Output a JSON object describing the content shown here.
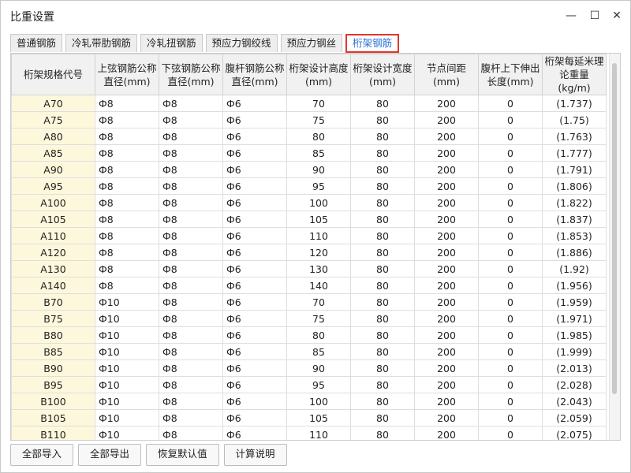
{
  "window": {
    "title": "比重设置"
  },
  "tabs": [
    {
      "label": "普通钢筋",
      "active": false
    },
    {
      "label": "冷轧带肋钢筋",
      "active": false
    },
    {
      "label": "冷轧扭钢筋",
      "active": false
    },
    {
      "label": "预应力钢绞线",
      "active": false
    },
    {
      "label": "预应力钢丝",
      "active": false
    },
    {
      "label": "桁架钢筋",
      "active": true
    }
  ],
  "table": {
    "headers": [
      "桁架规格代号",
      "上弦钢筋公称直径(mm)",
      "下弦钢筋公称直径(mm)",
      "腹杆钢筋公称直径(mm)",
      "桁架设计高度(mm)",
      "桁架设计宽度(mm)",
      "节点间距(mm)",
      "腹杆上下伸出长度(mm)",
      "桁架每延米理论重量(kg/m)"
    ],
    "rows": [
      [
        "A70",
        "Ф8",
        "Ф8",
        "Ф6",
        "70",
        "80",
        "200",
        "0",
        "(1.737)"
      ],
      [
        "A75",
        "Ф8",
        "Ф8",
        "Ф6",
        "75",
        "80",
        "200",
        "0",
        "(1.75)"
      ],
      [
        "A80",
        "Ф8",
        "Ф8",
        "Ф6",
        "80",
        "80",
        "200",
        "0",
        "(1.763)"
      ],
      [
        "A85",
        "Ф8",
        "Ф8",
        "Ф6",
        "85",
        "80",
        "200",
        "0",
        "(1.777)"
      ],
      [
        "A90",
        "Ф8",
        "Ф8",
        "Ф6",
        "90",
        "80",
        "200",
        "0",
        "(1.791)"
      ],
      [
        "A95",
        "Ф8",
        "Ф8",
        "Ф6",
        "95",
        "80",
        "200",
        "0",
        "(1.806)"
      ],
      [
        "A100",
        "Ф8",
        "Ф8",
        "Ф6",
        "100",
        "80",
        "200",
        "0",
        "(1.822)"
      ],
      [
        "A105",
        "Ф8",
        "Ф8",
        "Ф6",
        "105",
        "80",
        "200",
        "0",
        "(1.837)"
      ],
      [
        "A110",
        "Ф8",
        "Ф8",
        "Ф6",
        "110",
        "80",
        "200",
        "0",
        "(1.853)"
      ],
      [
        "A120",
        "Ф8",
        "Ф8",
        "Ф6",
        "120",
        "80",
        "200",
        "0",
        "(1.886)"
      ],
      [
        "A130",
        "Ф8",
        "Ф8",
        "Ф6",
        "130",
        "80",
        "200",
        "0",
        "(1.92)"
      ],
      [
        "A140",
        "Ф8",
        "Ф8",
        "Ф6",
        "140",
        "80",
        "200",
        "0",
        "(1.956)"
      ],
      [
        "B70",
        "Ф10",
        "Ф8",
        "Ф6",
        "70",
        "80",
        "200",
        "0",
        "(1.959)"
      ],
      [
        "B75",
        "Ф10",
        "Ф8",
        "Ф6",
        "75",
        "80",
        "200",
        "0",
        "(1.971)"
      ],
      [
        "B80",
        "Ф10",
        "Ф8",
        "Ф6",
        "80",
        "80",
        "200",
        "0",
        "(1.985)"
      ],
      [
        "B85",
        "Ф10",
        "Ф8",
        "Ф6",
        "85",
        "80",
        "200",
        "0",
        "(1.999)"
      ],
      [
        "B90",
        "Ф10",
        "Ф8",
        "Ф6",
        "90",
        "80",
        "200",
        "0",
        "(2.013)"
      ],
      [
        "B95",
        "Ф10",
        "Ф8",
        "Ф6",
        "95",
        "80",
        "200",
        "0",
        "(2.028)"
      ],
      [
        "B100",
        "Ф10",
        "Ф8",
        "Ф6",
        "100",
        "80",
        "200",
        "0",
        "(2.043)"
      ],
      [
        "B105",
        "Ф10",
        "Ф8",
        "Ф6",
        "105",
        "80",
        "200",
        "0",
        "(2.059)"
      ],
      [
        "B110",
        "Ф10",
        "Ф8",
        "Ф6",
        "110",
        "80",
        "200",
        "0",
        "(2.075)"
      ]
    ]
  },
  "buttons": {
    "import_all": "全部导入",
    "export_all": "全部导出",
    "restore_default": "恢复默认值",
    "calc_explain": "计算说明"
  },
  "colors": {
    "active_tab_border": "#e0362c",
    "active_tab_text": "#2a6fd6",
    "code_cell_bg": "#fdf8dc",
    "header_bg": "#f1f1f1"
  }
}
